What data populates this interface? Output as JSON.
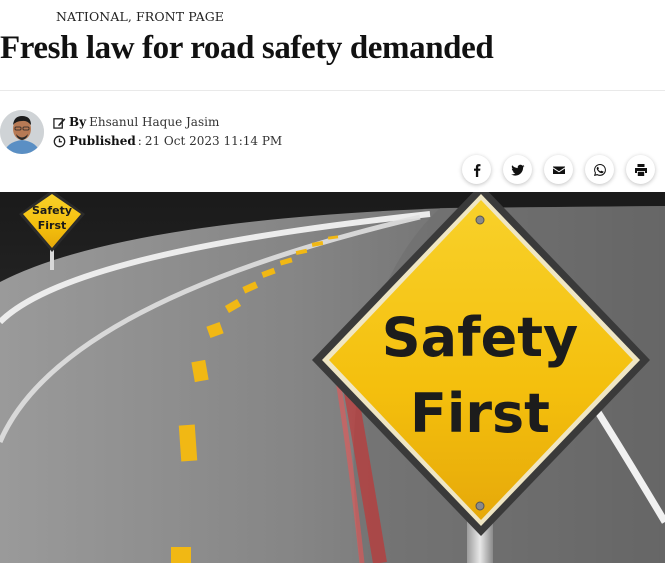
{
  "article": {
    "categories": [
      "NATIONAL",
      "FRONT PAGE"
    ],
    "category_separator": ", ",
    "headline": "Fresh law for road safety demanded",
    "byline": {
      "by_label": "By",
      "author": "Ehsanul Haque Jasim",
      "published_label": "Published",
      "published_separator": ":",
      "published_date": "21 Oct 2023 11:14 PM"
    }
  },
  "share": [
    {
      "name": "facebook",
      "icon": "facebook-icon"
    },
    {
      "name": "twitter",
      "icon": "twitter-icon"
    },
    {
      "name": "email",
      "icon": "envelope-icon"
    },
    {
      "name": "whatsapp",
      "icon": "whatsapp-icon"
    },
    {
      "name": "print",
      "icon": "print-icon"
    }
  ],
  "hero_image": {
    "small_sign_line1": "Safety",
    "small_sign_line2": "First",
    "big_sign_line1": "Safety",
    "big_sign_line2": "First",
    "colors": {
      "sign_yellow": "#f6c20f",
      "sign_border": "#2b2b2b",
      "road": "#8d8d8d",
      "lane_marks": "#f1b814",
      "sky": "#262626"
    }
  }
}
